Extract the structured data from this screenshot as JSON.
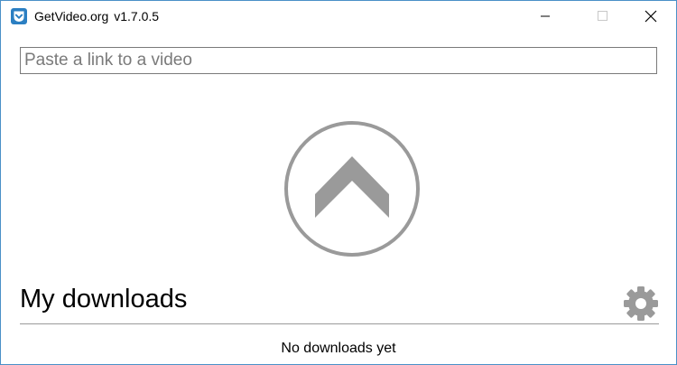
{
  "window": {
    "app_name": "GetVideo.org",
    "version": "v1.7.0.5"
  },
  "url_input": {
    "placeholder": "Paste a link to a video",
    "value": ""
  },
  "upload": {
    "icon": "chevron-up-icon"
  },
  "downloads": {
    "title": "My downloads",
    "empty_message": "No downloads yet",
    "settings_icon": "gear-icon"
  },
  "colors": {
    "accent": "#2b7fc2",
    "icon_gray": "#9a9a9a",
    "border": "#7a7a7a"
  }
}
